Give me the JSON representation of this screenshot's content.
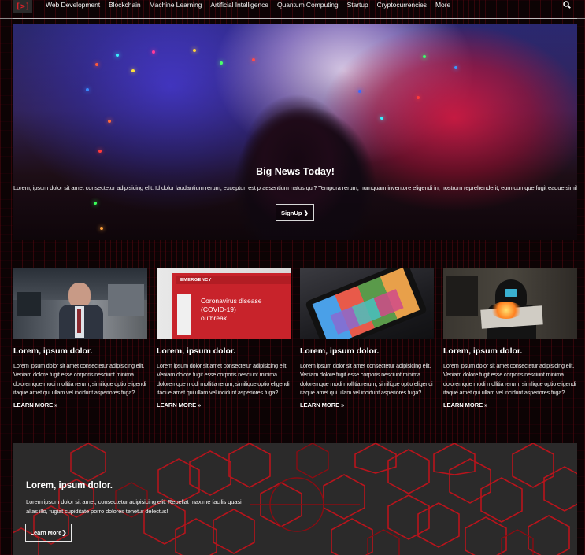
{
  "nav": {
    "logo": "[>]",
    "links": [
      "Web Development",
      "Blockchain",
      "Machine Learning",
      "Artificial Intelligence",
      "Quantum Computing",
      "Startup",
      "Cryptocurrencies",
      "More"
    ],
    "search_icon": "search-icon"
  },
  "hero": {
    "title": "Big News Today!",
    "text": "Lorem, ipsum dolor sit amet consectetur adipisicing elit. Id dolor laudantium rerum, excepturi est praesentium natus qui? Tempora rerum, numquam inventore eligendi in, nostrum reprehenderit, eum cumque fugit eaque similique!",
    "button": "SignUp ❯"
  },
  "cards": [
    {
      "title": "Lorem, ipsum dolor.",
      "text": "Lorem ipsum dolor sit amet consectetur adipisicing elit. Veniam dolore fugit esse corporis nesciunt minima doloremque modi mollitia rerum, similique optio eligendi itaque amet qui ullam vel incidunt asperiores fuga?",
      "link": "LEARN MORE »"
    },
    {
      "title": "Lorem, ipsum dolor.",
      "text": "Lorem ipsum dolor sit amet consectetur adipisicing elit. Veniam dolore fugit esse corporis nesciunt minima doloremque modi mollitia rerum, similique optio eligendi itaque amet qui ullam vel incidunt asperiores fuga?",
      "link": "LEARN MORE »",
      "image_sign": {
        "header": "EMERGENCY",
        "body": "Coronavirus disease (COVID-19) outbreak"
      }
    },
    {
      "title": "Lorem, ipsum dolor.",
      "text": "Lorem ipsum dolor sit amet consectetur adipisicing elit. Veniam dolore fugit esse corporis nesciunt minima doloremque modi mollitia rerum, similique optio eligendi itaque amet qui ullam vel incidunt asperiores fuga?",
      "link": "LEARN MORE »"
    },
    {
      "title": "Lorem, ipsum dolor.",
      "text": "Lorem ipsum dolor sit amet consectetur adipisicing elit. Veniam dolore fugit esse corporis nesciunt minima doloremque modi mollitia rerum, similique optio eligendi itaque amet qui ullam vel incidunt asperiores fuga?",
      "link": "LEARN MORE »"
    }
  ],
  "banner": {
    "title": "Lorem, ipsum dolor.",
    "text": "Lorem ipsum dolor sit amet, consectetur adipisicing elit. Repellat maxime facilis quasi alias illo, fugiat cupiditate porro dolores tenetur delectus!",
    "button": "Learn More❯"
  },
  "colors": {
    "accent_red": "#e0222a",
    "banner_bg": "#2b2a2a",
    "hex_stroke": "#c01018"
  }
}
